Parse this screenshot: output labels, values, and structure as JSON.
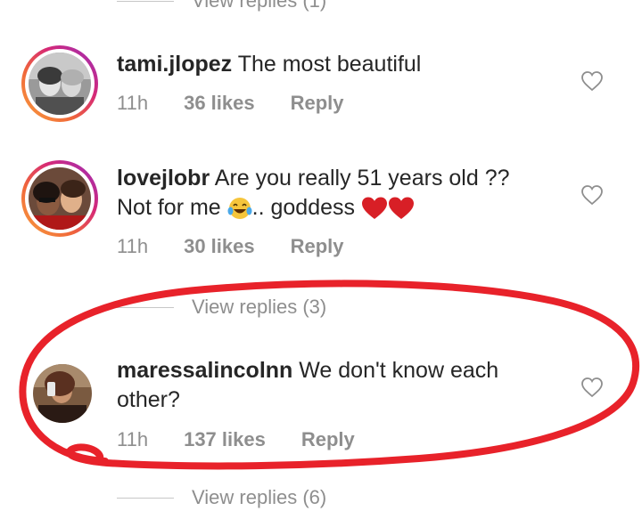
{
  "replies_top": {
    "label": "View replies (1)"
  },
  "comments": [
    {
      "username": "tami.jlopez",
      "text": "The most beautiful",
      "time": "11h",
      "likes": "36 likes",
      "reply": "Reply"
    },
    {
      "username": "lovejlobr",
      "text_line1": "Are you really 51 years old ??",
      "text_line2_prefix": "Not for me",
      "text_line2_suffix": ".. goddess",
      "time": "11h",
      "likes": "30 likes",
      "reply": "Reply"
    },
    {
      "username": "maressalincolnn",
      "text": "We don't know each other?",
      "time": "11h",
      "likes": "137 likes",
      "reply": "Reply"
    }
  ],
  "replies_mid": {
    "label": "View replies (3)"
  },
  "replies_bottom": {
    "label": "View replies (6)"
  },
  "icons": {
    "like": "heart-outline-icon",
    "laugh": "tears-of-joy-emoji",
    "heart": "red-heart-emoji"
  },
  "colors": {
    "text": "#262626",
    "secondary": "#8e8e8e",
    "annotation": "#e8222a"
  }
}
